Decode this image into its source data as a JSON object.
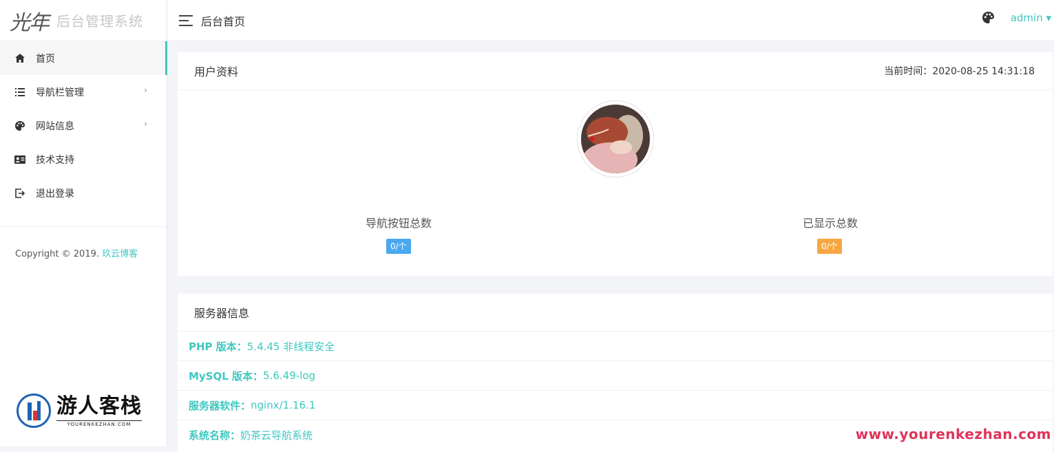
{
  "sidebar": {
    "logo_mark": "光年",
    "logo_text": "后台管理系统",
    "items": [
      {
        "label": "首页",
        "icon": "home-icon"
      },
      {
        "label": "导航栏管理",
        "icon": "list-icon"
      },
      {
        "label": "网站信息",
        "icon": "palette-icon"
      },
      {
        "label": "技术支持",
        "icon": "id-card-icon"
      },
      {
        "label": "退出登录",
        "icon": "logout-icon"
      }
    ],
    "copyright_prefix": "Copyright © 2019. ",
    "copyright_link": "玖云博客"
  },
  "header": {
    "title": "后台首页",
    "user": "admin ▾"
  },
  "profile": {
    "title": "用户资料",
    "time_label": "当前时间：",
    "time_value": "2020-08-25 14:31:18",
    "stats": [
      {
        "label": "导航按钮总数",
        "value": "0/个",
        "color": "#4aa8f0"
      },
      {
        "label": "已显示总数",
        "value": "0/个",
        "color": "#f6a743"
      }
    ]
  },
  "server": {
    "title": "服务器信息",
    "rows": [
      {
        "key": "PHP 版本：",
        "value": "5.4.45 非线程安全"
      },
      {
        "key": "MySQL 版本：",
        "value": "5.6.49-log"
      },
      {
        "key": "服务器软件：",
        "value": "nginx/1.16.1"
      },
      {
        "key": "系统名称：",
        "value": "奶茶云导航系统"
      }
    ]
  },
  "watermark": {
    "cn": "游人客栈",
    "en": "YOURENKEZHAN.COM",
    "url": "www.yourenkezhan.com"
  },
  "colors": {
    "accent": "#3ec7c0",
    "blue_badge": "#4aa8f0",
    "orange_badge": "#f6a743"
  }
}
